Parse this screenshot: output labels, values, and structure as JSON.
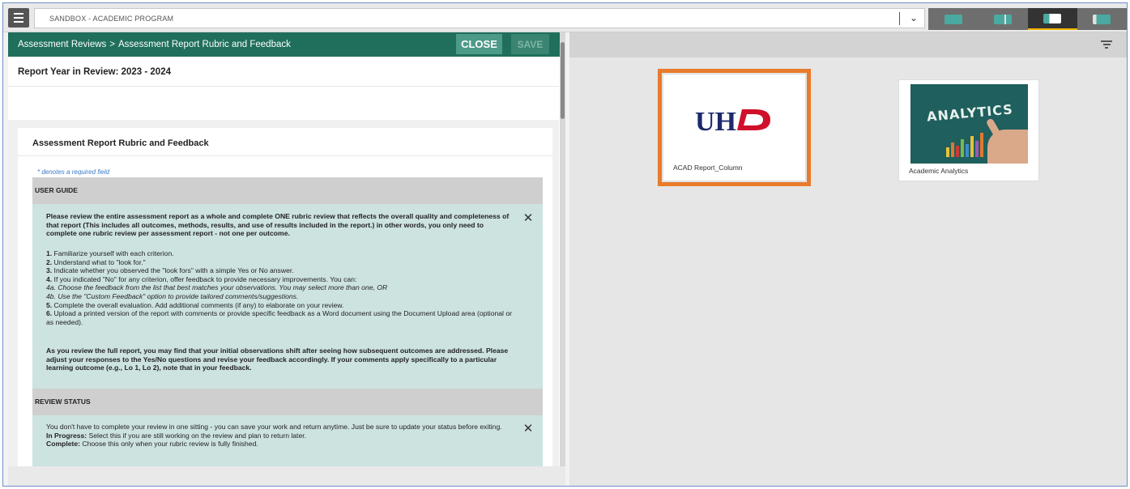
{
  "topbar": {
    "context": "SANDBOX - ACADEMIC PROGRAM",
    "layout_buttons": [
      "layout-1",
      "layout-2",
      "layout-3",
      "layout-4"
    ]
  },
  "left_panel": {
    "breadcrumb": {
      "parent": "Assessment Reviews",
      "separator": ">",
      "current": "Assessment Report Rubric and Feedback"
    },
    "close_label": "CLOSE",
    "save_label": "SAVE",
    "report_year": "Report Year in Review: 2023 - 2024",
    "card": {
      "title": "Assessment Report Rubric and Feedback",
      "required_note": "* denotes a required field",
      "user_guide": {
        "heading": "USER GUIDE",
        "intro": "Please review the entire assessment report as a whole and complete ONE rubric review that reflects the overall quality and completeness of that report (This includes all outcomes, methods, results, and use of results included in the report.) in other words, you only need to complete one rubric review per assessment report - not one per outcome.",
        "steps": [
          {
            "num": "1.",
            "text": " Familiarize yourself with each criterion."
          },
          {
            "num": "2.",
            "text": " Understand what to \"look for.\""
          },
          {
            "num": "3.",
            "text": " Indicate whether you observed the \"look fors\" with a simple Yes or No answer."
          },
          {
            "num": "4.",
            "text": " If you indicated \"No\" for any criterion, offer feedback to provide necessary improvements. You can:"
          },
          {
            "num": "",
            "text": "4a. Choose the feedback from the list that best matches your observations. You may select more than one, OR",
            "italic": true
          },
          {
            "num": "",
            "text": "4b. Use the \"Custom Feedback\" option to provide tailored comments/suggestions.",
            "italic": true
          },
          {
            "num": "5.",
            "text": " Complete the overall evaluation. Add additional comments (if any) to elaborate on your review."
          },
          {
            "num": "6.",
            "text": " Upload a printed version of the report with comments or provide specific feedback as a Word document using the Document Upload area (optional or as needed)."
          }
        ],
        "closing": "As you review the full report, you may find that your initial observations shift after seeing how subsequent outcomes are addressed. Please adjust your responses to the Yes/No questions and revise your feedback accordingly. If your comments apply specifically to a particular learning outcome (e.g., Lo 1, Lo 2), note that in your feedback."
      },
      "review_status": {
        "heading": "REVIEW STATUS",
        "intro": "You don't have to complete your review in one sitting - you can save your work and return anytime. Just be sure to update your status before exiting.",
        "in_progress_label": "In Progress:",
        "in_progress_text": " Select this if you are still working on the review and plan to return later.",
        "complete_label": "Complete:",
        "complete_text": " Choose this only when your rubric review is fully finished."
      }
    }
  },
  "right_panel": {
    "tiles": [
      {
        "label": "ACAD Report_Column",
        "logo_text": "UHD",
        "highlighted": true
      },
      {
        "label": "Academic Analytics",
        "image_text": "ANALYTICS"
      }
    ]
  },
  "colors": {
    "header_green": "#1f6f5c",
    "info_teal": "#cde3e0",
    "highlight_orange": "#e87b2c",
    "uhd_navy": "#1c2a6b",
    "uhd_red": "#d0102a"
  }
}
